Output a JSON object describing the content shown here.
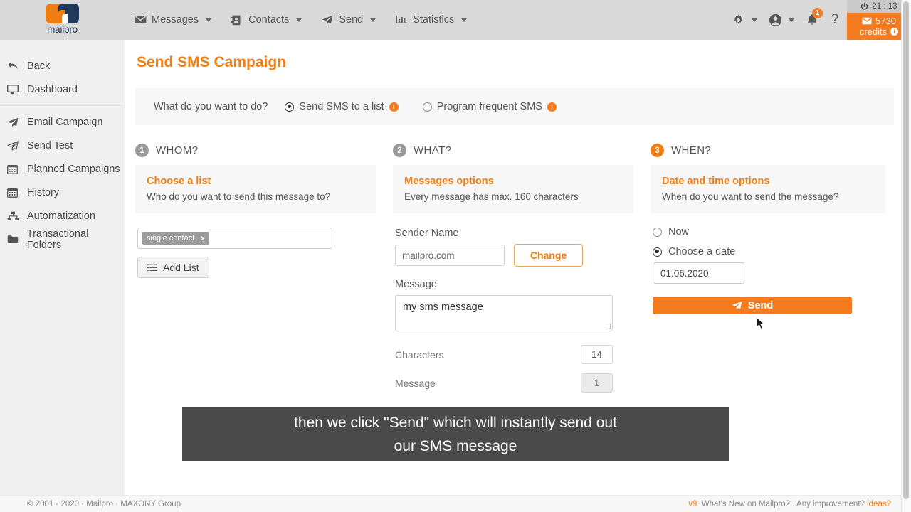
{
  "topnav": {
    "logo_text": "mailpro",
    "items": [
      {
        "label": "Messages",
        "icon": "envelope-icon"
      },
      {
        "label": "Contacts",
        "icon": "address-book-icon"
      },
      {
        "label": "Send",
        "icon": "paper-plane-icon"
      },
      {
        "label": "Statistics",
        "icon": "bar-chart-icon"
      }
    ],
    "gear_icon": "gear-icon",
    "user_icon": "user-circle-icon",
    "bell_icon": "bell-icon",
    "bell_badge": "1",
    "help_label": "?",
    "time": "21 : 13",
    "power_icon": "power-icon",
    "credits_value": "5730",
    "credits_label": "credits",
    "accent_color": "#f47b20"
  },
  "sidebar": {
    "items": [
      {
        "label": "Back",
        "icon": "back-arrow-icon"
      },
      {
        "label": "Dashboard",
        "icon": "monitor-icon"
      },
      {
        "label": "Email Campaign",
        "icon": "paper-plane-icon"
      },
      {
        "label": "Send Test",
        "icon": "paper-plane-outline-icon"
      },
      {
        "label": "Planned Campaigns",
        "icon": "calendar-icon"
      },
      {
        "label": "History",
        "icon": "calendar-icon"
      },
      {
        "label": "Automatization",
        "icon": "sitemap-icon"
      },
      {
        "label": "Transactional Folders",
        "icon": "folder-icon"
      }
    ]
  },
  "main": {
    "page_title": "Send SMS Campaign",
    "whatdo": {
      "question": "What do you want to do?",
      "options": [
        {
          "label": "Send SMS to a list",
          "selected": true,
          "info": "i"
        },
        {
          "label": "Program frequent SMS",
          "selected": false,
          "info": "i"
        }
      ]
    },
    "step_whom": {
      "number": "1",
      "title": "WHOM?",
      "card_title": "Choose a list",
      "card_sub": "Who do you want to send this message to?",
      "tag": "single contact",
      "tag_remove": "x",
      "add_list_label": "Add List",
      "add_list_icon": "list-icon"
    },
    "step_what": {
      "number": "2",
      "title": "WHAT?",
      "card_title": "Messages options",
      "card_sub": "Every message has max. 160 characters",
      "sender_label": "Sender Name",
      "sender_value": "mailpro.com",
      "change_label": "Change",
      "message_label": "Message",
      "message_value": "my sms message",
      "characters_label": "Characters",
      "characters_value": "14",
      "message_count_label": "Message",
      "message_count_value": "1"
    },
    "step_when": {
      "number": "3",
      "title": "WHEN?",
      "card_title": "Date and time options",
      "card_sub": "When do you want to send the message?",
      "now_label": "Now",
      "now_selected": false,
      "choose_date_label": "Choose a date",
      "choose_date_selected": true,
      "date_value": "01.06.2020",
      "send_label": "Send",
      "send_icon": "paper-plane-icon"
    }
  },
  "caption": {
    "line1": "then we click \"Send\" which will instantly send out",
    "line2": "our SMS message"
  },
  "footer": {
    "left": "© 2001 - 2020 · Mailpro · MAXONY Group",
    "version": "v9",
    "right_text": ". What's New on Mailpro? . Any improvement? ",
    "ideas": "ideas?"
  }
}
